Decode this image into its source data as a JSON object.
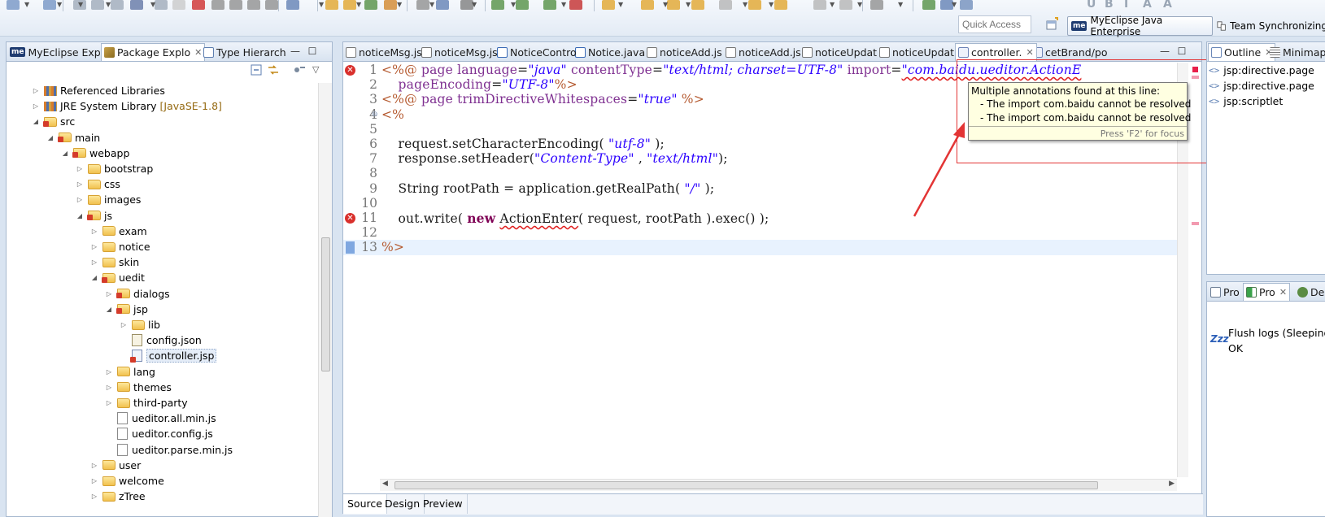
{
  "toolbar": {
    "quick_access_placeholder": "Quick Access",
    "perspectives": [
      {
        "badge": "me",
        "label": "MyEclipse Java Enterprise"
      },
      {
        "label": "Team Synchronizing"
      }
    ]
  },
  "left_panel": {
    "tabs": [
      {
        "label": "MyEclipse Expl",
        "icon": "myeclipse-explorer-icon"
      },
      {
        "label": "Package Explo",
        "icon": "package-explorer-icon",
        "active": true
      },
      {
        "label": "Type Hierarch",
        "icon": "type-hierarchy-icon"
      }
    ],
    "tree": [
      {
        "label": "Referenced Libraries",
        "type": "library",
        "depth": 2,
        "expanded": false
      },
      {
        "label": "JRE System Library",
        "decoration": "[JavaSE-1.8]",
        "type": "library",
        "depth": 2,
        "expanded": false
      },
      {
        "label": "src",
        "type": "folder-pkg",
        "depth": 2,
        "expanded": true
      },
      {
        "label": "main",
        "type": "folder-pkg",
        "depth": 3,
        "expanded": true
      },
      {
        "label": "webapp",
        "type": "folder-pkg",
        "depth": 4,
        "expanded": true
      },
      {
        "label": "bootstrap",
        "type": "folder",
        "depth": 5,
        "expanded": false
      },
      {
        "label": "css",
        "type": "folder",
        "depth": 5,
        "expanded": false
      },
      {
        "label": "images",
        "type": "folder",
        "depth": 5,
        "expanded": false
      },
      {
        "label": "js",
        "type": "folder-pkg",
        "depth": 5,
        "expanded": true
      },
      {
        "label": "exam",
        "type": "folder",
        "depth": 6,
        "expanded": false
      },
      {
        "label": "notice",
        "type": "folder",
        "depth": 6,
        "expanded": false
      },
      {
        "label": "skin",
        "type": "folder",
        "depth": 6,
        "expanded": false
      },
      {
        "label": "uedit",
        "type": "folder-pkg",
        "depth": 6,
        "expanded": true
      },
      {
        "label": "dialogs",
        "type": "folder-pkg",
        "depth": 7,
        "expanded": false
      },
      {
        "label": "jsp",
        "type": "folder-pkg",
        "depth": 7,
        "expanded": true
      },
      {
        "label": "lib",
        "type": "folder",
        "depth": 8,
        "expanded": false
      },
      {
        "label": "config.json",
        "type": "file-json",
        "depth": 8
      },
      {
        "label": "controller.jsp",
        "type": "file-jsp",
        "depth": 8,
        "selected": true
      },
      {
        "label": "lang",
        "type": "folder",
        "depth": 7,
        "expanded": false
      },
      {
        "label": "themes",
        "type": "folder",
        "depth": 7,
        "expanded": false
      },
      {
        "label": "third-party",
        "type": "folder",
        "depth": 7,
        "expanded": false
      },
      {
        "label": "ueditor.all.min.js",
        "type": "file-js",
        "depth": 7
      },
      {
        "label": "ueditor.config.js",
        "type": "file-js",
        "depth": 7
      },
      {
        "label": "ueditor.parse.min.js",
        "type": "file-js",
        "depth": 7
      },
      {
        "label": "user",
        "type": "folder",
        "depth": 6,
        "expanded": false
      },
      {
        "label": "welcome",
        "type": "folder",
        "depth": 6,
        "expanded": false
      },
      {
        "label": "zTree",
        "type": "folder",
        "depth": 6,
        "expanded": false
      }
    ]
  },
  "editor": {
    "tabs": [
      {
        "label": "noticeMsg.js",
        "icon": "js-file-icon"
      },
      {
        "label": "noticeMsg.js",
        "icon": "js-file-icon"
      },
      {
        "label": "NoticeContro",
        "icon": "java-file-icon"
      },
      {
        "label": "Notice.java",
        "icon": "java-file-icon"
      },
      {
        "label": "noticeAdd.js",
        "icon": "js-file-icon"
      },
      {
        "label": "noticeAdd.js",
        "icon": "js-file-icon"
      },
      {
        "label": "noticeUpdat",
        "icon": "js-file-icon"
      },
      {
        "label": "noticeUpdat",
        "icon": "js-file-icon"
      },
      {
        "label": "controller.",
        "icon": "jsp-file-icon",
        "active": true
      },
      {
        "label": "cetBrand/po",
        "icon": "jsp-file-icon"
      }
    ],
    "lines": [
      {
        "n": "1",
        "error": true,
        "segments": [
          {
            "t": "<%@ ",
            "c": "dir"
          },
          {
            "t": "page ",
            "c": "kw-attr"
          },
          {
            "t": "language",
            "c": "kw-attr"
          },
          {
            "t": "=",
            "c": "code-plain"
          },
          {
            "t": "\"java\"",
            "c": "str"
          },
          {
            "t": " contentType",
            "c": "kw-attr"
          },
          {
            "t": "=",
            "c": "code-plain"
          },
          {
            "t": "\"text/html; charset=UTF-8\"",
            "c": "str"
          },
          {
            "t": " import",
            "c": "kw-attr"
          },
          {
            "t": "=",
            "c": "code-plain"
          },
          {
            "t": "\"com.baidu.ueditor.ActionE",
            "c": "str squiggle"
          }
        ]
      },
      {
        "n": "2",
        "segments": [
          {
            "t": "    pageEncoding",
            "c": "kw-attr"
          },
          {
            "t": "=",
            "c": "code-plain"
          },
          {
            "t": "\"UTF-8\"",
            "c": "str"
          },
          {
            "t": "%>",
            "c": "dir"
          }
        ]
      },
      {
        "n": "3",
        "segments": [
          {
            "t": "<%@ ",
            "c": "dir"
          },
          {
            "t": "page trimDirectiveWhitespaces",
            "c": "kw-attr"
          },
          {
            "t": "=",
            "c": "code-plain"
          },
          {
            "t": "\"true\"",
            "c": "str"
          },
          {
            "t": " %>",
            "c": "dir"
          }
        ]
      },
      {
        "n": "4",
        "fold": true,
        "segments": [
          {
            "t": "<%",
            "c": "dir"
          }
        ]
      },
      {
        "n": "5",
        "segments": []
      },
      {
        "n": "6",
        "segments": [
          {
            "t": "    request.setCharacterEncoding( ",
            "c": "code-plain"
          },
          {
            "t": "\"utf-8\"",
            "c": "str"
          },
          {
            "t": " );",
            "c": "code-plain"
          }
        ]
      },
      {
        "n": "7",
        "segments": [
          {
            "t": "    response.setHeader(",
            "c": "code-plain"
          },
          {
            "t": "\"Content-Type\"",
            "c": "str"
          },
          {
            "t": " , ",
            "c": "code-plain"
          },
          {
            "t": "\"text/html\"",
            "c": "str"
          },
          {
            "t": ");",
            "c": "code-plain"
          }
        ]
      },
      {
        "n": "8",
        "segments": []
      },
      {
        "n": "9",
        "segments": [
          {
            "t": "    String rootPath = application.getRealPath( ",
            "c": "code-plain"
          },
          {
            "t": "\"/\"",
            "c": "str"
          },
          {
            "t": " );",
            "c": "code-plain"
          }
        ]
      },
      {
        "n": "10",
        "segments": []
      },
      {
        "n": "11",
        "error": true,
        "segments": [
          {
            "t": "    out.write( ",
            "c": "code-plain"
          },
          {
            "t": "new",
            "c": "kw"
          },
          {
            "t": " ",
            "c": "code-plain"
          },
          {
            "t": "ActionEnter",
            "c": "code-plain squiggle"
          },
          {
            "t": "( request, rootPath ).exec() );",
            "c": "code-plain"
          }
        ]
      },
      {
        "n": "12",
        "segments": []
      },
      {
        "n": "13",
        "current": true,
        "bookmark": true,
        "segments": [
          {
            "t": "%>",
            "c": "dir"
          }
        ]
      }
    ],
    "bottom_tabs": [
      {
        "label": "Source",
        "active": true
      },
      {
        "label": "Design"
      },
      {
        "label": "Preview"
      }
    ],
    "hover": {
      "title": "Multiple annotations found at this line:",
      "items": [
        "- The import com.baidu cannot be resolved",
        "- The import com.baidu cannot be resolved"
      ],
      "footer": "Press 'F2' for focus"
    }
  },
  "outline_panel": {
    "tabs": [
      {
        "label": "Outline",
        "icon": "outline-icon",
        "active": true
      },
      {
        "label": "Minimap",
        "icon": "minimap-icon"
      }
    ],
    "items": [
      {
        "label": "jsp:directive.page",
        "icon": "<>"
      },
      {
        "label": "jsp:directive.page",
        "icon": "<>"
      },
      {
        "label": "jsp:scriptlet",
        "icon": "<>"
      }
    ]
  },
  "progress_panel": {
    "tabs": [
      {
        "label": "Pro",
        "icon": "properties-icon"
      },
      {
        "label": "Pro",
        "icon": "progress-icon",
        "active": true
      },
      {
        "label": "Deb",
        "icon": "debug-icon"
      }
    ],
    "zzz": "Zzz",
    "job": "Flush logs (Sleeping)",
    "status": "OK"
  },
  "colors": {
    "error": "#d9302c",
    "string": "#2b00ff",
    "attribute": "#7f3091",
    "keyword": "#7f0055",
    "annotation_box": "#e33535",
    "tooltip_bg": "#ffffe1"
  }
}
